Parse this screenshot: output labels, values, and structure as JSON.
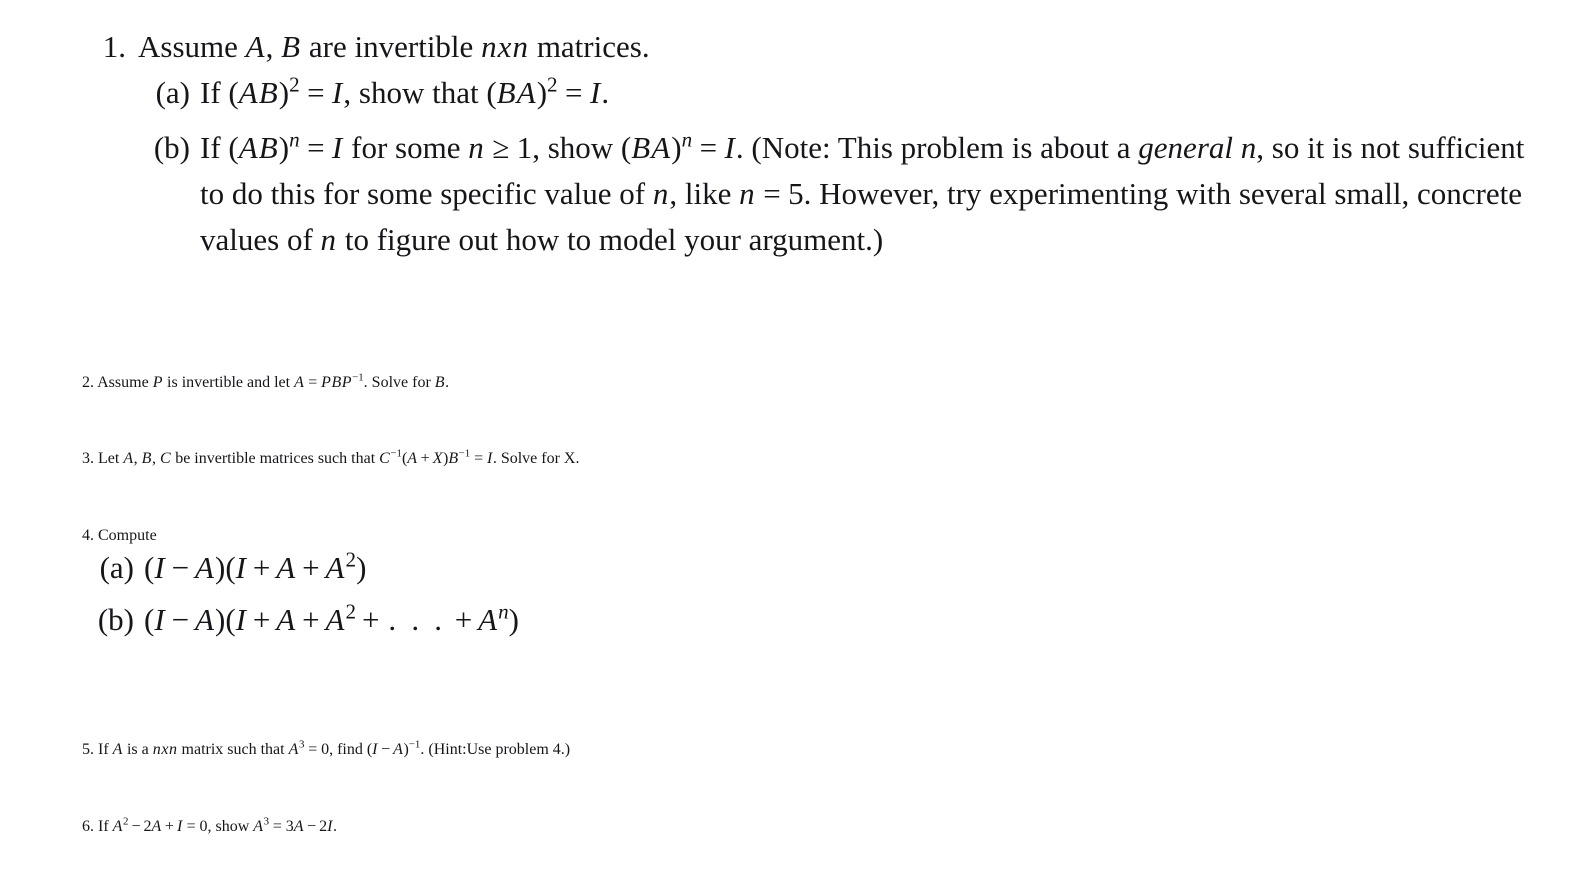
{
  "document": {
    "kind": "math-problem-set",
    "background_color": "#ffffff",
    "text_color": "#16161a",
    "problems": [
      {
        "number": "1.",
        "stem_plain": "Assume A, B are invertible nxn matrices.",
        "stem": {
          "t1": "Assume ",
          "A": "A",
          "comma": ", ",
          "B": "B",
          "t2": " are invertible ",
          "n1": "n",
          "x": "x",
          "n2": "n",
          "t3": " matrices."
        },
        "subitems": [
          {
            "label": "(a)",
            "plain": "If (AB)^2 = I, show that (BA)^2 = I.",
            "parts": {
              "if": "If ",
              "lp1": "(",
              "A": "A",
              "B": "B",
              "rp1": ")",
              "exp2a": "2",
              "eq1": "=",
              "I1": "I",
              "comma": ", show that ",
              "lp2": "(",
              "B2": "B",
              "A2": "A",
              "rp2": ")",
              "exp2b": "2",
              "eq2": "=",
              "I2": "I",
              "period": "."
            }
          },
          {
            "label": "(b)",
            "plain": "If (AB)^n = I for some n >= 1, show (BA)^n = I. (Note: This problem is about a general n, so it is not sufficient to do this for some specific value of n, like n = 5. However, try experimenting with several small, concrete values of n to figure out how to model your argument.)",
            "parts": {
              "if": "If ",
              "lp1": "(",
              "A": "A",
              "B": "B",
              "rp1": ")",
              "expn1": "n",
              "eq1": "=",
              "I1": "I",
              "forsome": " for some ",
              "n_cond": "n",
              "ge": "≥",
              "one": "1",
              "showtxt": ", show ",
              "lp2": "(",
              "B2": "B",
              "A2": "A",
              "rp2": ")",
              "expn2": "n",
              "eq2": "=",
              "I2": "I",
              "note_open": ". (Note: This problem is about a ",
              "emph_general": "general n",
              "note_mid1": ", so it is not sufficient to do this for some specific value of ",
              "n_val": "n",
              "note_mid2": ", like ",
              "n_like": "n",
              "eq3": "=",
              "five": "5",
              "note_mid3": ". However, try experimenting with several small, concrete values of ",
              "n_small": "n",
              "note_mid4": " to figure out how to model your argument.)"
            }
          }
        ]
      },
      {
        "number": "2.",
        "plain": "Assume P is invertible and let A = PBP^-1. Solve for B.",
        "parts": {
          "t1": "Assume ",
          "P": "P",
          "t2": " is invertible and let ",
          "A": "A",
          "eq": "=",
          "P2": "P",
          "B2": "B",
          "P3": "P",
          "exp_neg1": "−1",
          "t3": ". Solve for ",
          "B": "B",
          "period": "."
        }
      },
      {
        "number": "3.",
        "plain": "Let A, B, C be invertible matrices such that C^-1(A + X)B^-1 = I. Solve for X.",
        "parts": {
          "t1": "Let ",
          "A": "A",
          "c1": ", ",
          "B": "B",
          "c2": ", ",
          "C": "C",
          "t2": " be invertible matrices such that ",
          "C2": "C",
          "exp_neg1a": "−1",
          "lp": "(",
          "A2": "A",
          "plus": "+",
          "X": "X",
          "rp": ")",
          "B2": "B",
          "exp_neg1b": "−1",
          "eq": "=",
          "I": "I",
          "t3": ". Solve for ",
          "X_upright": "X",
          "period": "."
        }
      },
      {
        "number": "4.",
        "plain": "Compute",
        "stem_text": "Compute",
        "subitems": [
          {
            "label": "(a)",
            "plain": "(I - A)(I + A + A^2)",
            "parts": {
              "lp1": "(",
              "I1": "I",
              "minus": "−",
              "A1": "A",
              "rp1": ")",
              "lp2": "(",
              "I2": "I",
              "plus1": "+",
              "A2": "A",
              "plus2": "+",
              "A3": "A",
              "exp2": "2",
              "rp2": ")"
            }
          },
          {
            "label": "(b)",
            "plain": "(I - A)(I + A + A^2 + ... + A^n)",
            "parts": {
              "lp1": "(",
              "I1": "I",
              "minus": "−",
              "A1": "A",
              "rp1": ")",
              "lp2": "(",
              "I2": "I",
              "plus1": "+",
              "A2": "A",
              "plus2": "+",
              "A3": "A",
              "exp2": "2",
              "plus3": "+",
              "dots": ". . .",
              "plus4": "+",
              "A4": "A",
              "expn": "n",
              "rp2": ")"
            }
          }
        ]
      },
      {
        "number": "5.",
        "plain": "If A is a nxn matrix such that A^3 = 0, find (I - A)^-1. (Hint:Use problem 4.)",
        "parts": {
          "t1": "If ",
          "A": "A",
          "t2": " is a ",
          "n1": "n",
          "x": "x",
          "n2": "n",
          "t3": " matrix such that ",
          "A2": "A",
          "exp3": "3",
          "eq": "=",
          "zero": "0",
          "t4": ", find ",
          "lp": "(",
          "I": "I",
          "minus": "−",
          "A3": "A",
          "rp": ")",
          "exp_neg1": "−1",
          "t5": ". (Hint:Use problem 4.)"
        }
      },
      {
        "number": "6.",
        "plain": "If A^2 - 2A + I = 0, show A^3 = 3A - 2I.",
        "parts": {
          "t1": "If ",
          "A1": "A",
          "exp2": "2",
          "minus1": "−",
          "two1": "2",
          "A2": "A",
          "plus": "+",
          "I1": "I",
          "eq1": "=",
          "zero": "0",
          "t2": ", show ",
          "A3": "A",
          "exp3": "3",
          "eq2": "=",
          "three": "3",
          "A4": "A",
          "minus2": "−",
          "two2": "2",
          "I2": "I",
          "period": "."
        }
      }
    ]
  }
}
